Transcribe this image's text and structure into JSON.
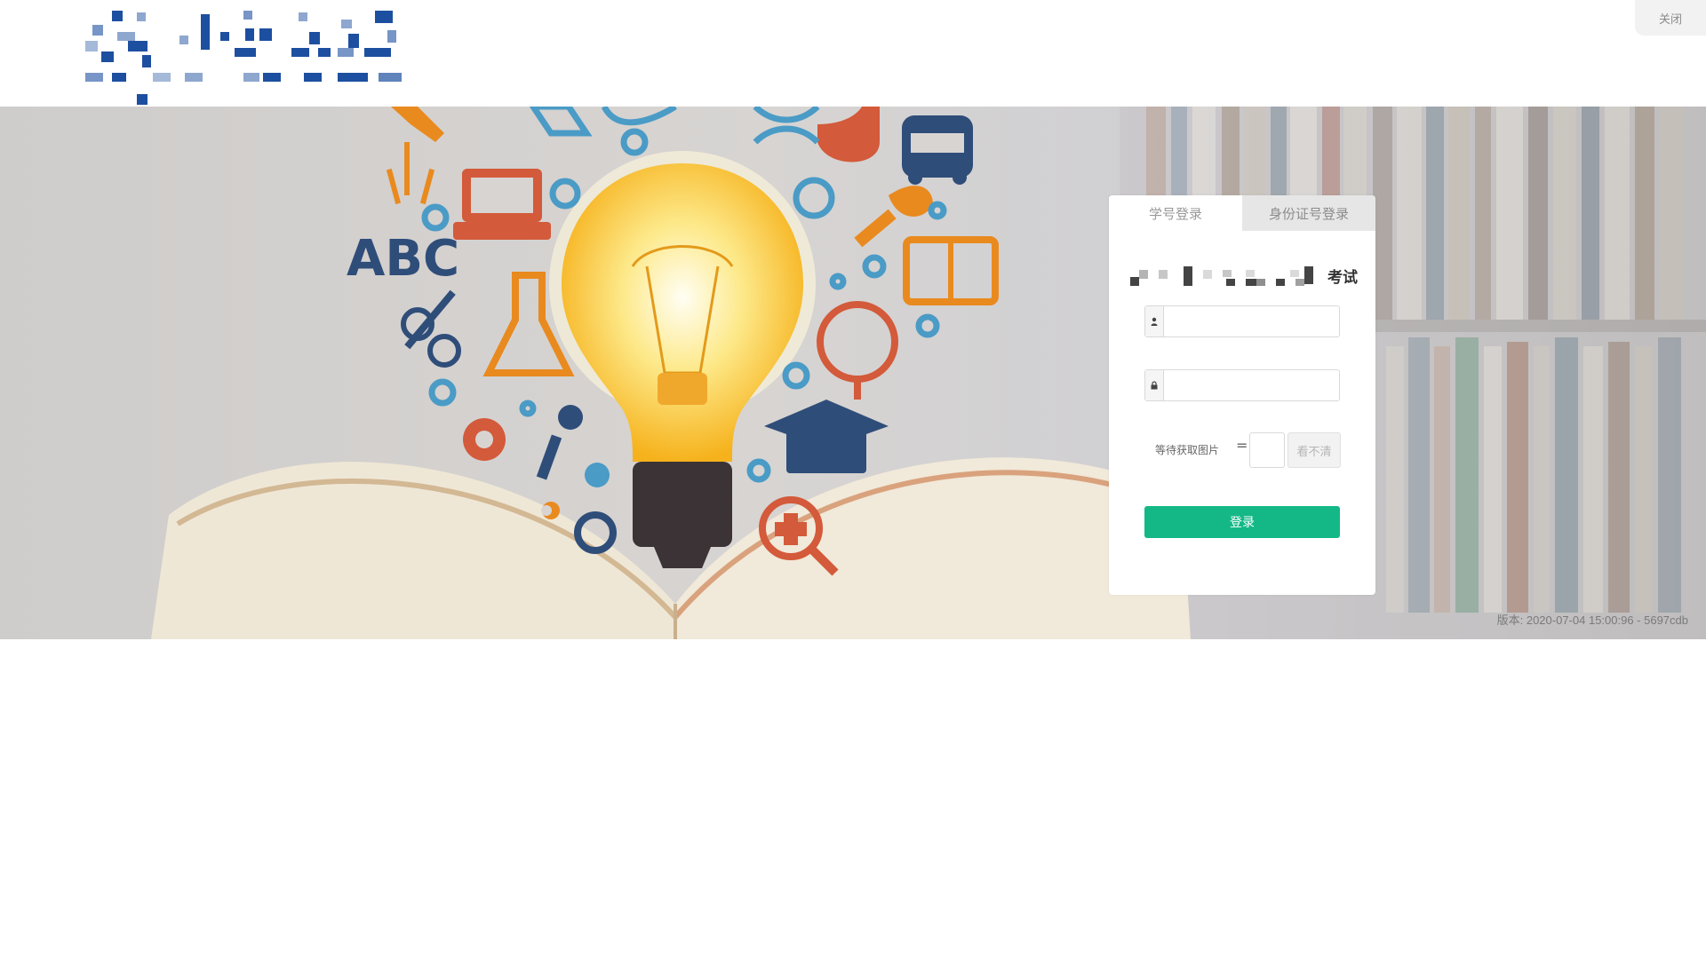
{
  "header": {
    "close_label": "关闭"
  },
  "login": {
    "tabs": [
      {
        "label": "学号登录",
        "active": true
      },
      {
        "label": "身份证号登录",
        "active": false
      }
    ],
    "exam_title_suffix": "考试",
    "username": {
      "icon": "user-icon",
      "value": "",
      "placeholder": ""
    },
    "password": {
      "icon": "lock-icon",
      "value": "",
      "placeholder": ""
    },
    "captcha": {
      "hint": "等待获取图片",
      "equals": "=",
      "value": "",
      "refresh_label": "看不清"
    },
    "submit_label": "登录"
  },
  "footer": {
    "version": "版本: 2020-07-04 15:00:96 - 5697cdb"
  },
  "colors": {
    "primary_button": "#14b886",
    "logo_blue": "#1d4fa0"
  }
}
